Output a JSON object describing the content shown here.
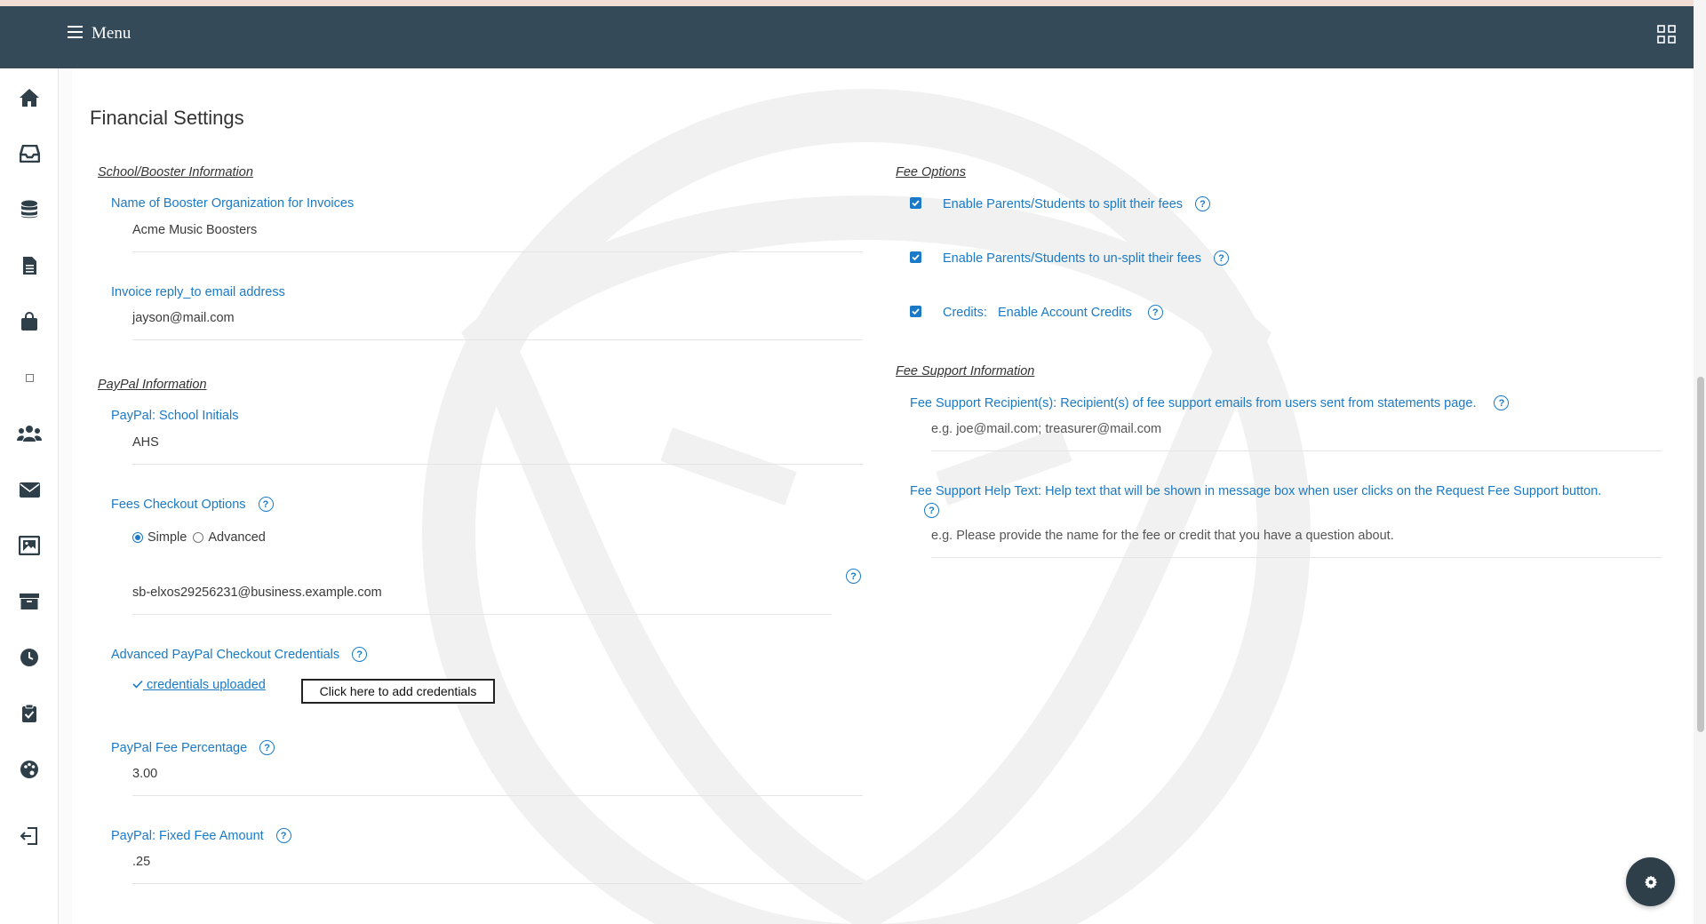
{
  "header": {
    "menu_label": "Menu",
    "menu_icon": "hamburger-icon",
    "apps_icon": "grid-icon"
  },
  "sidebar": {
    "items": [
      {
        "icon": "home-icon"
      },
      {
        "icon": "inbox-icon"
      },
      {
        "icon": "database-icon"
      },
      {
        "icon": "document-icon"
      },
      {
        "icon": "shopping-bag-icon"
      },
      {
        "icon": "square-icon"
      },
      {
        "icon": "users-icon"
      },
      {
        "icon": "envelope-icon"
      },
      {
        "icon": "image-gallery-icon"
      },
      {
        "icon": "archive-icon"
      },
      {
        "icon": "clock-icon"
      },
      {
        "icon": "clipboard-check-icon"
      },
      {
        "icon": "palette-icon"
      },
      {
        "icon": "sign-out-icon"
      }
    ]
  },
  "page": {
    "title": "Financial Settings"
  },
  "school_booster": {
    "section_title": "School/Booster Information",
    "org_name_label": "Name of Booster Organization for Invoices",
    "org_name_value": "Acme Music Boosters",
    "reply_to_label": "Invoice reply_to email address",
    "reply_to_value": "jayson@mail.com"
  },
  "paypal": {
    "section_title": "PayPal Information",
    "school_initials_label": "PayPal: School Initials",
    "school_initials_value": "AHS",
    "checkout_options_label": "Fees Checkout Options",
    "checkout_option_simple": "Simple",
    "checkout_option_advanced": "Advanced",
    "checkout_selected": "Simple",
    "business_email_value": "sb-elxos29256231@business.example.com",
    "advanced_credentials_label": "Advanced PayPal Checkout Credentials",
    "credentials_status": "credentials uploaded",
    "add_credentials_button": "Click here to add credentials",
    "fee_percentage_label": "PayPal Fee Percentage",
    "fee_percentage_value": "3.00",
    "fixed_fee_label": "PayPal: Fixed Fee Amount",
    "fixed_fee_value": ".25"
  },
  "fee_options": {
    "section_title": "Fee Options",
    "split_label": "Enable Parents/Students to split their fees",
    "split_checked": true,
    "unsplit_label": "Enable Parents/Students to un-split their fees",
    "unsplit_checked": true,
    "credits_prefix": "Credits:",
    "credits_label": "Enable Account Credits",
    "credits_checked": true
  },
  "fee_support": {
    "section_title": "Fee Support Information",
    "recipients_label": "Fee Support Recipient(s): Recipient(s) of fee support emails from users sent from statements page.",
    "recipients_placeholder": "e.g. joe@mail.com; treasurer@mail.com",
    "help_text_label": "Fee Support Help Text: Help text that will be shown in message box when user clicks on the Request Fee Support button.",
    "help_text_placeholder": "e.g. Please provide the name for the fee or credit that you have a question about."
  },
  "help_glyph": "?",
  "colors": {
    "topbar": "#354a59",
    "accent": "#1a7ac7",
    "fab": "#2e3f4a"
  }
}
